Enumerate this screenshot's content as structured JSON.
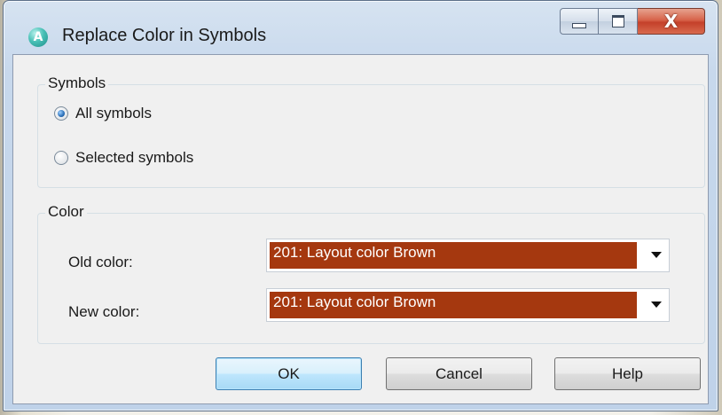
{
  "window": {
    "title": "Replace Color in Symbols",
    "app_icon_letter": "A",
    "minimize_icon": "minimize-icon",
    "maximize_icon": "maximize-icon",
    "close_glyph": "X"
  },
  "symbols_group": {
    "label": "Symbols",
    "options": [
      {
        "label": "All symbols",
        "checked": true
      },
      {
        "label": "Selected symbols",
        "checked": false
      }
    ]
  },
  "color_group": {
    "label": "Color",
    "old_color_label": "Old color:",
    "old_color_value": "201: Layout color Brown",
    "new_color_label": "New color:",
    "new_color_value": "201: Layout color Brown",
    "swatch_color": "#a5380f"
  },
  "buttons": {
    "ok": "OK",
    "cancel": "Cancel",
    "help": "Help"
  }
}
